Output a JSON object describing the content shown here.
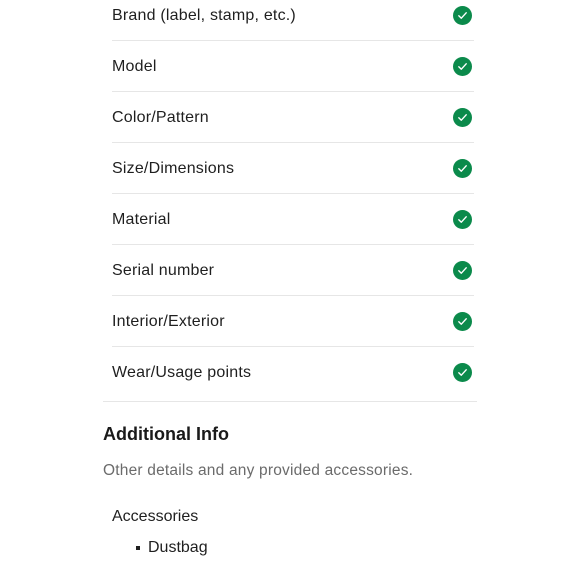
{
  "checklist": {
    "items": [
      {
        "label": "Brand (label, stamp, etc.)",
        "status": "verified",
        "icon": "check-circle-icon"
      },
      {
        "label": "Model",
        "status": "verified",
        "icon": "check-circle-icon"
      },
      {
        "label": "Color/Pattern",
        "status": "verified",
        "icon": "check-circle-icon"
      },
      {
        "label": "Size/Dimensions",
        "status": "verified",
        "icon": "check-circle-icon"
      },
      {
        "label": "Material",
        "status": "verified",
        "icon": "check-circle-icon"
      },
      {
        "label": "Serial number",
        "status": "verified",
        "icon": "check-circle-icon"
      },
      {
        "label": "Interior/Exterior",
        "status": "verified",
        "icon": "check-circle-icon"
      },
      {
        "label": "Wear/Usage points",
        "status": "verified",
        "icon": "check-circle-icon"
      }
    ],
    "check_color": "#0b8a4b"
  },
  "additional_info": {
    "title": "Additional Info",
    "subtitle": "Other details and any provided accessories.",
    "accessories": {
      "heading": "Accessories",
      "items": [
        "Dustbag"
      ]
    }
  }
}
